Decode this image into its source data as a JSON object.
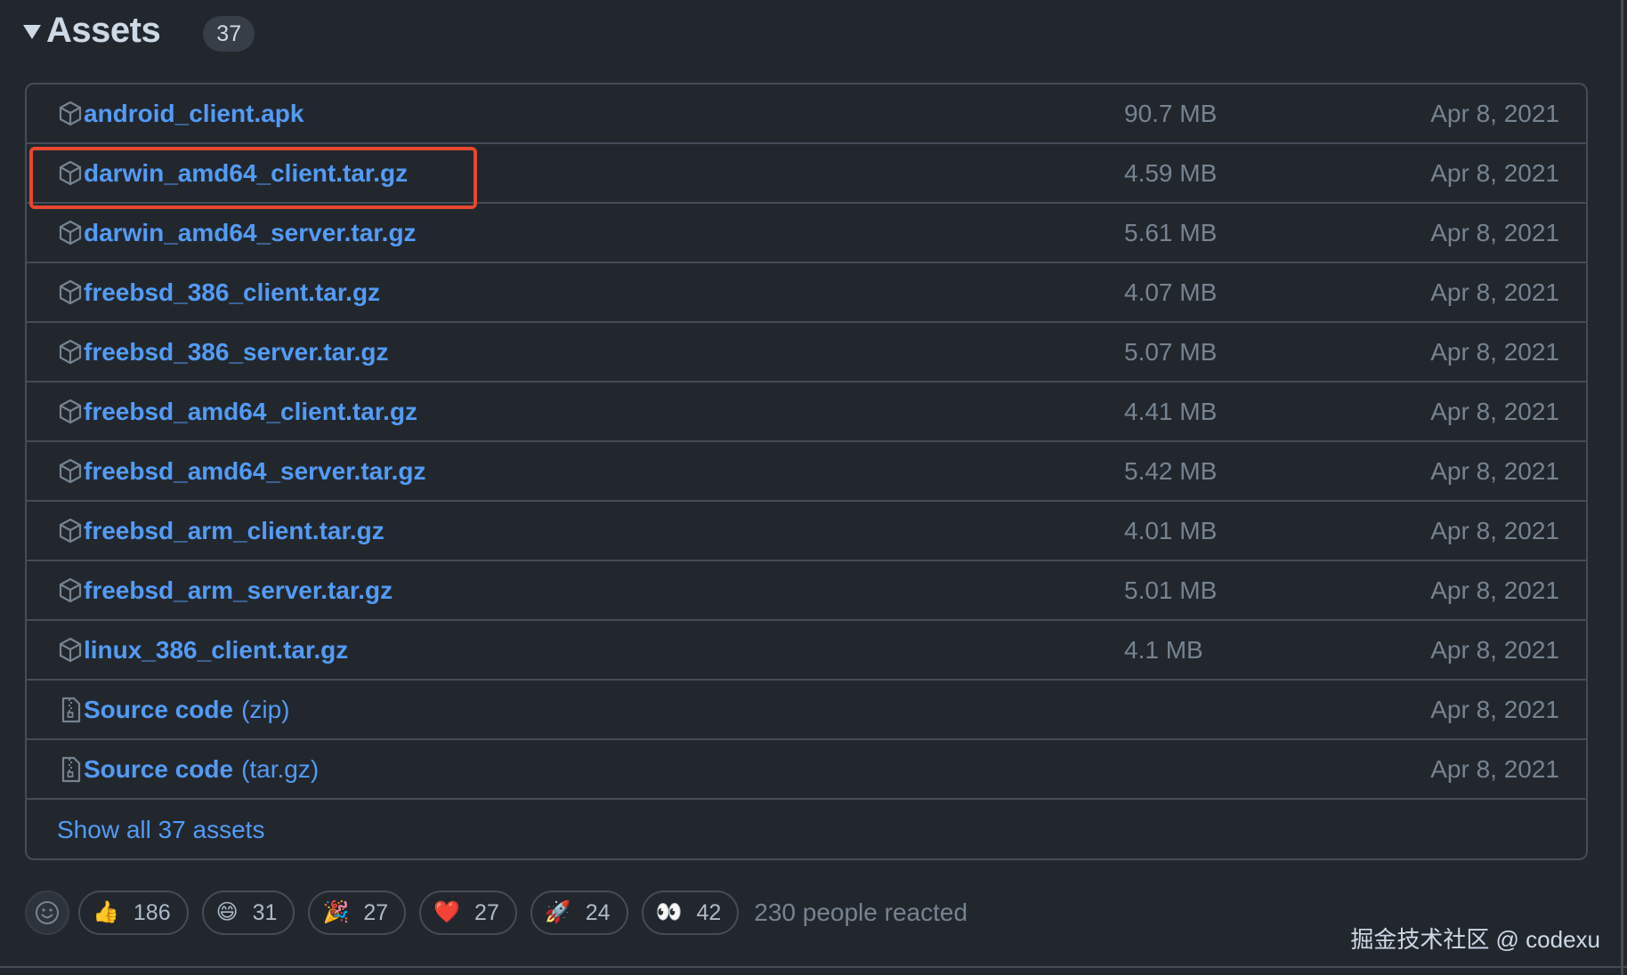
{
  "assets": {
    "title": "Assets",
    "count": "37",
    "items": [
      {
        "name": "android_client.apk",
        "size": "90.7 MB",
        "date": "Apr 8, 2021",
        "icon": "package-icon"
      },
      {
        "name": "darwin_amd64_client.tar.gz",
        "size": "4.59 MB",
        "date": "Apr 8, 2021",
        "icon": "package-icon"
      },
      {
        "name": "darwin_amd64_server.tar.gz",
        "size": "5.61 MB",
        "date": "Apr 8, 2021",
        "icon": "package-icon"
      },
      {
        "name": "freebsd_386_client.tar.gz",
        "size": "4.07 MB",
        "date": "Apr 8, 2021",
        "icon": "package-icon"
      },
      {
        "name": "freebsd_386_server.tar.gz",
        "size": "5.07 MB",
        "date": "Apr 8, 2021",
        "icon": "package-icon"
      },
      {
        "name": "freebsd_amd64_client.tar.gz",
        "size": "4.41 MB",
        "date": "Apr 8, 2021",
        "icon": "package-icon"
      },
      {
        "name": "freebsd_amd64_server.tar.gz",
        "size": "5.42 MB",
        "date": "Apr 8, 2021",
        "icon": "package-icon"
      },
      {
        "name": "freebsd_arm_client.tar.gz",
        "size": "4.01 MB",
        "date": "Apr 8, 2021",
        "icon": "package-icon"
      },
      {
        "name": "freebsd_arm_server.tar.gz",
        "size": "5.01 MB",
        "date": "Apr 8, 2021",
        "icon": "package-icon"
      },
      {
        "name": "linux_386_client.tar.gz",
        "size": "4.1 MB",
        "date": "Apr 8, 2021",
        "icon": "package-icon"
      }
    ],
    "source_items": [
      {
        "name": "Source code",
        "suffix": "(zip)",
        "date": "Apr 8, 2021",
        "icon": "file-zip-icon"
      },
      {
        "name": "Source code",
        "suffix": "(tar.gz)",
        "date": "Apr 8, 2021",
        "icon": "file-zip-icon"
      }
    ],
    "show_all_label": "Show all 37 assets",
    "highlighted_item": "darwin_amd64_client.tar.gz"
  },
  "reactions": {
    "picker_icon": "smiley-icon",
    "items": [
      {
        "emoji": "👍",
        "name": "thumbs-up",
        "count": "186"
      },
      {
        "emoji": "😄",
        "name": "laugh",
        "count": "31"
      },
      {
        "emoji": "🎉",
        "name": "hooray",
        "count": "27"
      },
      {
        "emoji": "❤️",
        "name": "heart",
        "count": "27"
      },
      {
        "emoji": "🚀",
        "name": "rocket",
        "count": "24"
      },
      {
        "emoji": "👀",
        "name": "eyes",
        "count": "42"
      }
    ],
    "summary": "230 people reacted"
  },
  "watermark": "掘金技术社区 @ codexu",
  "colors": {
    "background": "#22272e",
    "border": "#444c56",
    "link": "#539bf5",
    "muted_text": "#768390",
    "highlight_box": "#e5472f"
  }
}
